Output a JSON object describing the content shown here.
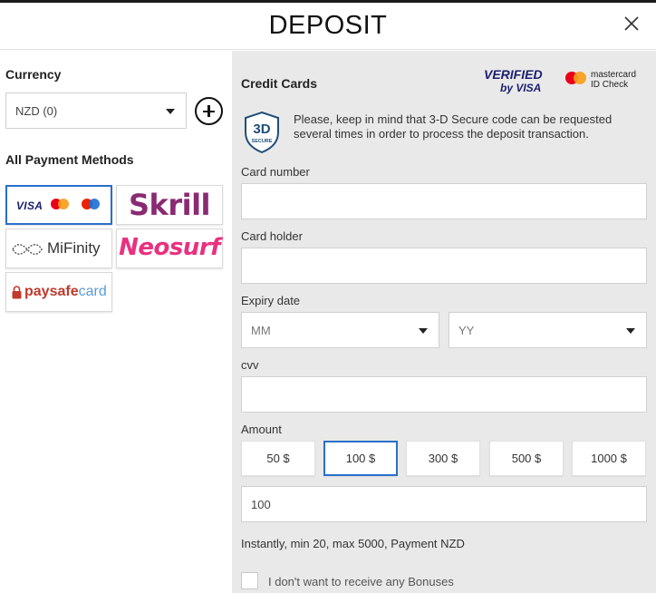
{
  "header": {
    "title": "DEPOSIT"
  },
  "left": {
    "currency_label": "Currency",
    "currency_value": "NZD (0)",
    "methods_label": "All Payment Methods",
    "methods": {
      "cards_visa": "VISA",
      "skrill": "Skrill",
      "mifinity": "MiFinity",
      "neosurf": "Neosurf",
      "paysafe_a": "paysafe",
      "paysafe_b": "card"
    }
  },
  "main": {
    "section_title": "Credit Cards",
    "vbv_line1": "VERIFIED",
    "vbv_line2": "by VISA",
    "mcid_line1": "mastercard",
    "mcid_line2": "ID Check",
    "ds_badge_top": "3D",
    "ds_badge_bottom": "SECURE",
    "secure_notice": "Please, keep in mind that 3-D Secure code can be requested several times in order to process the deposit transaction.",
    "card_number_label": "Card number",
    "card_holder_label": "Card holder",
    "expiry_label": "Expiry date",
    "expiry_month": "MM",
    "expiry_year": "YY",
    "cvv_label": "cvv",
    "amount_label": "Amount",
    "amounts": [
      "50 $",
      "100 $",
      "300 $",
      "500 $",
      "1000 $"
    ],
    "selected_amount_index": 1,
    "amount_value": "100",
    "limits_text": "Instantly, min 20, max 5000, Payment NZD",
    "bonus_checkbox_label": "I don't want to receive any Bonuses"
  },
  "colors": {
    "accent": "#2a6fc9",
    "panel_bg": "#e9e9e9",
    "skrill": "#8a2a73",
    "neosurf": "#e8317f"
  }
}
